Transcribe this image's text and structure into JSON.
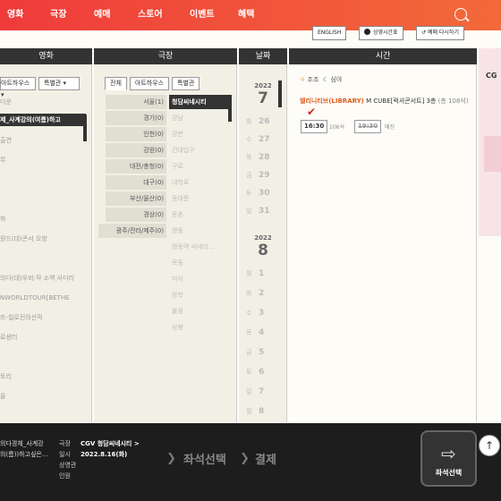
{
  "nav": {
    "items": [
      "영화",
      "극장",
      "예매",
      "스토어",
      "이벤트",
      "혜택"
    ]
  },
  "subbar": {
    "english": "ENGLISH",
    "schedule": "상영시간표",
    "reset": "예매 다시하기"
  },
  "movie": {
    "header": "영화",
    "tabs": [
      "아트하우스",
      "특별관"
    ],
    "items": [
      "다운",
      "제_사계강의(여름)하고",
      "출연",
      "무",
      "",
      "하",
      "원드(대)콘서 오방",
      "",
      "의다경체 계가",
      "의다(대)우비:작 소역 사다리",
      "NWORLDTOUR[BETHE",
      "뜨-칠로전의산작",
      "로센터",
      "",
      "",
      "토리",
      "을"
    ]
  },
  "theater": {
    "header": "극장",
    "tabs": [
      "전체",
      "아트하우스",
      "특별관"
    ],
    "regions": [
      "서울(1)",
      "경기(0)",
      "인천(0)",
      "강원(0)",
      "대전/충청(0)",
      "대구(0)",
      "부산/울산(0)",
      "경상(0)",
      "광주/전라/제주(0)"
    ],
    "theaters": [
      "청담씨네시티",
      "강남",
      "강변",
      "건대입구",
      "구로",
      "대학로",
      "동대문",
      "등촌",
      "명동",
      "명동역 씨네라...",
      "목동",
      "미아",
      "방학",
      "불광",
      "상봉"
    ]
  },
  "date": {
    "header": "날짜",
    "year1": "2022",
    "month1": "7",
    "days1": [
      [
        "화",
        "26"
      ],
      [
        "수",
        "27"
      ],
      [
        "목",
        "28"
      ],
      [
        "금",
        "29"
      ],
      [
        "토",
        "30"
      ],
      [
        "일",
        "31"
      ]
    ],
    "year2": "2022",
    "month2": "8",
    "days2": [
      [
        "월",
        "1"
      ],
      [
        "화",
        "2"
      ],
      [
        "수",
        "3"
      ],
      [
        "목",
        "4"
      ],
      [
        "금",
        "5"
      ],
      [
        "토",
        "6"
      ],
      [
        "일",
        "7"
      ],
      [
        "월",
        "8"
      ]
    ]
  },
  "time": {
    "header": "시간",
    "morning": "조조",
    "night": "심야",
    "hall": "M CUBE[럭셔콘서트] 3층",
    "title": "엘리니티브(LIBRARY)",
    "seatinfo": "(총 108석)",
    "showtimes": [
      {
        "time": "16:30",
        "seats": "106석"
      },
      {
        "time": "19:30",
        "seats": "매진"
      }
    ]
  },
  "bottom": {
    "movie": "의다경체_사계강",
    "movie2": "의(름))하고싶은...",
    "l_theater": "극장",
    "l_date": "일시",
    "l_hall": "상영관",
    "l_people": "인원",
    "theater_val": "CGV 청담씨네시티 >",
    "date_val": "2022.8.16(화)",
    "step_seat": "좌석선택",
    "step_pay": "결제",
    "seat_btn": "좌석선택"
  }
}
